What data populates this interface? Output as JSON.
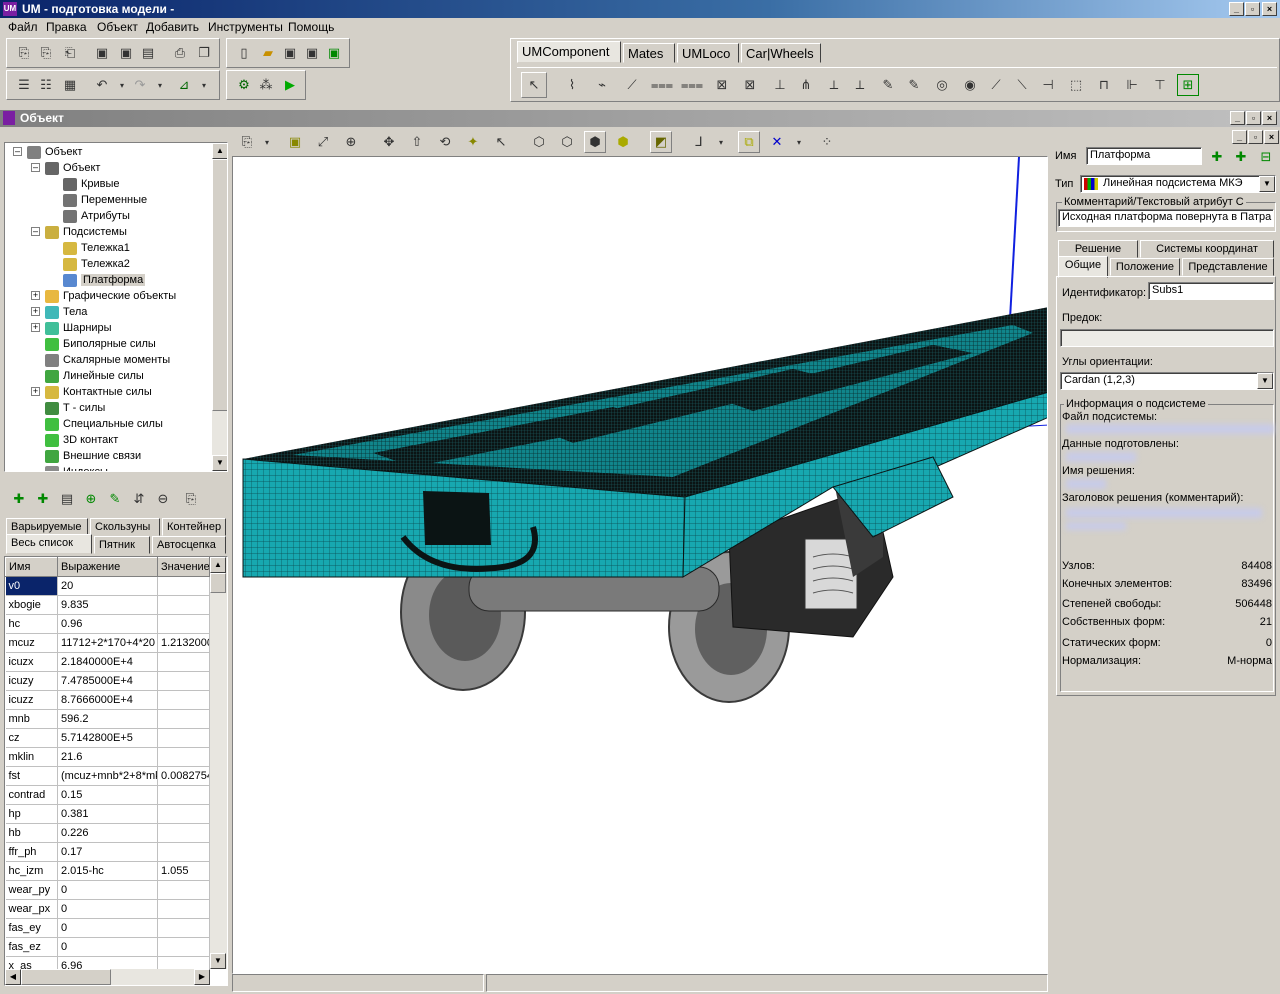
{
  "window": {
    "title": "UM - подготовка модели -",
    "logo": "UM"
  },
  "menu": [
    "Файл",
    "Правка",
    "Объект",
    "Добавить",
    "Инструменты",
    "Помощь"
  ],
  "component_tabs": [
    "UMComponent",
    "Mates",
    "UMLoco",
    "Car|Wheels"
  ],
  "object_panel": {
    "title": "Объект",
    "tree": [
      {
        "label": "Объект",
        "indent": 0,
        "icon": "car-icon",
        "expander": "-"
      },
      {
        "label": "Объект",
        "indent": 1,
        "icon": "hammer-icon",
        "expander": "-"
      },
      {
        "label": "Кривые",
        "indent": 2,
        "icon": "curve-icon",
        "expander": ""
      },
      {
        "label": "Переменные",
        "indent": 2,
        "icon": "function-icon",
        "expander": ""
      },
      {
        "label": "Атрибуты",
        "indent": 2,
        "icon": "abc-icon",
        "expander": ""
      },
      {
        "label": "Подсистемы",
        "indent": 1,
        "icon": "subsystems-icon",
        "expander": "-"
      },
      {
        "label": "Тележка1",
        "indent": 2,
        "icon": "subsystem-icon",
        "expander": ""
      },
      {
        "label": "Тележка2",
        "indent": 2,
        "icon": "subsystem-icon",
        "expander": ""
      },
      {
        "label": "Платформа",
        "indent": 2,
        "icon": "fem-subsystem-icon",
        "expander": "",
        "selected": true
      },
      {
        "label": "Графические объекты",
        "indent": 1,
        "icon": "graphics-icon",
        "expander": "+"
      },
      {
        "label": "Тела",
        "indent": 1,
        "icon": "bodies-icon",
        "expander": "+"
      },
      {
        "label": "Шарниры",
        "indent": 1,
        "icon": "joints-icon",
        "expander": "+"
      },
      {
        "label": "Биполярные силы",
        "indent": 1,
        "icon": "bipolar-force-icon",
        "expander": ""
      },
      {
        "label": "Скалярные моменты",
        "indent": 1,
        "icon": "scalar-torque-icon",
        "expander": ""
      },
      {
        "label": "Линейные силы",
        "indent": 1,
        "icon": "linear-force-icon",
        "expander": ""
      },
      {
        "label": "Контактные силы",
        "indent": 1,
        "icon": "contact-force-icon",
        "expander": "+"
      },
      {
        "label": "T - силы",
        "indent": 1,
        "icon": "t-force-icon",
        "expander": ""
      },
      {
        "label": "Специальные силы",
        "indent": 1,
        "icon": "special-force-icon",
        "expander": ""
      },
      {
        "label": "3D контакт",
        "indent": 1,
        "icon": "contact-3d-icon",
        "expander": ""
      },
      {
        "label": "Внешние связи",
        "indent": 1,
        "icon": "external-links-icon",
        "expander": ""
      },
      {
        "label": "Индексы",
        "indent": 1,
        "icon": "index-icon",
        "expander": ""
      }
    ]
  },
  "param_tabs": {
    "row1": [
      "Варьируемые",
      "Скользуны",
      "Контейнер"
    ],
    "row2": [
      "Весь список",
      "Пятник",
      "Автосцепка"
    ]
  },
  "param_table": {
    "headers": [
      "Имя",
      "Выражение",
      "Значение"
    ],
    "rows": [
      [
        "v0",
        "20",
        ""
      ],
      [
        "xbogie",
        "9.835",
        ""
      ],
      [
        "hc",
        "0.96",
        ""
      ],
      [
        "mcuz",
        "11712+2*170+4*20",
        "1.2132000"
      ],
      [
        "icuzx",
        "2.1840000E+4",
        ""
      ],
      [
        "icuzy",
        "7.4785000E+4",
        ""
      ],
      [
        "icuzz",
        "8.7666000E+4",
        ""
      ],
      [
        "mnb",
        "596.2",
        ""
      ],
      [
        "cz",
        "5.7142800E+5",
        ""
      ],
      [
        "mklin",
        "21.6",
        ""
      ],
      [
        "fst",
        "(mcuz+mnb*2+8*mkl",
        "0.0082754"
      ],
      [
        "contrad",
        "0.15",
        ""
      ],
      [
        "hp",
        "0.381",
        ""
      ],
      [
        "hb",
        "0.226",
        ""
      ],
      [
        "ffr_ph",
        "0.17",
        ""
      ],
      [
        "hc_izm",
        "2.015-hc",
        "1.055"
      ],
      [
        "wear_py",
        "0",
        ""
      ],
      [
        "wear_px",
        "0",
        ""
      ],
      [
        "fas_ey",
        "0",
        ""
      ],
      [
        "fas_ez",
        "0",
        ""
      ],
      [
        "x_as",
        "6.96",
        ""
      ]
    ]
  },
  "inspector": {
    "name_label": "Имя",
    "name_value": "Платформа",
    "type_label": "Тип",
    "type_value": "Линейная подсистема МКЭ",
    "comment_label": "Комментарий/Текстовый атрибут С",
    "comment_value": "Исходная платформа повернута в Патра",
    "tabs_row1": [
      "Решение",
      "Системы координат"
    ],
    "tabs_row2": [
      "Общие",
      "Положение",
      "Представление"
    ],
    "id_label": "Идентификатор:",
    "id_value": "Subs1",
    "parent_label": "Предок:",
    "parent_value": "",
    "angles_label": "Углы ориентации:",
    "angles_value": "Cardan (1,2,3)",
    "info_title": "Информация о подсистеме",
    "info_labels": [
      "Файл подсистемы:",
      "Данные подготовлены:",
      "Имя решения:",
      "Заголовок решения (комментарий):"
    ],
    "stats": [
      {
        "k": "Узлов:",
        "v": "84408"
      },
      {
        "k": "Конечных элементов:",
        "v": "83496"
      },
      {
        "k": "Степеней свободы:",
        "v": "506448"
      },
      {
        "k": "Собственных форм:",
        "v": "21"
      },
      {
        "k": "Статических форм:",
        "v": "0"
      },
      {
        "k": "Нормализация:",
        "v": "М-норма"
      }
    ]
  },
  "colors": {
    "mesh": "#17a8b0",
    "frame_dark": "#0b1414",
    "viewport_bg": "#ffffff",
    "axis_blue": "#1020e0"
  }
}
